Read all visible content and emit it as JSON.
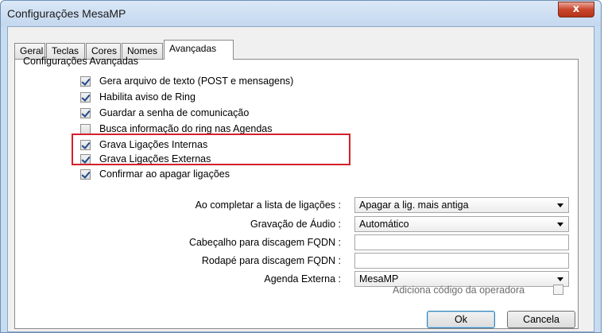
{
  "window": {
    "title": "Configurações MesaMP",
    "close_label": "x"
  },
  "tabs": [
    {
      "label": "Geral"
    },
    {
      "label": "Teclas"
    },
    {
      "label": "Cores"
    },
    {
      "label": "Nomes"
    },
    {
      "label": "Avançadas",
      "active": true
    }
  ],
  "section_title": "Configurações Avançadas",
  "checkboxes": [
    {
      "label": "Gera arquivo de texto (POST e mensagens)",
      "checked": true
    },
    {
      "label": "Habilita aviso de Ring",
      "checked": true
    },
    {
      "label": "Guardar a senha de comunicação",
      "checked": true
    },
    {
      "label": "Busca informação do ring nas Agendas",
      "checked": false
    },
    {
      "label": "Grava Ligações Internas",
      "checked": true
    },
    {
      "label": "Grava Ligações Externas",
      "checked": true
    },
    {
      "label": "Confirmar ao apagar ligações",
      "checked": true
    }
  ],
  "form": {
    "completar_label": "Ao completar a lista de ligações :",
    "completar_value": "Apagar a lig. mais antiga",
    "gravacao_label": "Gravação de Áudio :",
    "gravacao_value": "Automático",
    "cabecalho_label": "Cabeçalho para discagem FQDN :",
    "cabecalho_value": "",
    "rodape_label": "Rodapé para discagem FQDN :",
    "rodape_value": "",
    "agenda_label": "Agenda Externa :",
    "agenda_value": "MesaMP",
    "operadora_label": "Adiciona código da operadora",
    "operadora_checked": false
  },
  "buttons": {
    "ok": "Ok",
    "cancel": "Cancela"
  },
  "colors": {
    "highlight": "#d51f2b",
    "close": "#c9462c",
    "frame": "#c7dbf1"
  }
}
